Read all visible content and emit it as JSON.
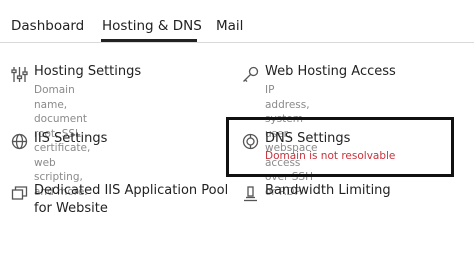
{
  "tabs": [
    {
      "label": "Dashboard"
    },
    {
      "label": "Hosting & DNS"
    },
    {
      "label": "Mail"
    }
  ],
  "items": {
    "hosting_settings": {
      "icon": "sliders-icon",
      "title": "Hosting Settings",
      "desc1": "Domain name, document root, SSL",
      "desc2": "certificate, web scripting, and more."
    },
    "web_hosting_access": {
      "icon": "key-icon",
      "title": "Web Hosting Access",
      "desc1": "IP address, system user, webspace",
      "desc2": "access over SSH or RDP."
    },
    "iis_settings": {
      "icon": "globe-gear-icon",
      "title": "IIS Settings"
    },
    "dns_settings": {
      "icon": "globe-icon",
      "title": "DNS Settings",
      "error": "Domain is not resolvable"
    },
    "dedicated_pool": {
      "icon": "windows-icon",
      "title1": "Dedicated IIS Application Pool",
      "title2": "for Website"
    },
    "bandwidth_limiting": {
      "icon": "bandwidth-icon",
      "title": "Bandwidth Limiting"
    }
  },
  "colors": {
    "error": "#c8323c",
    "highlight_border": "#111111",
    "muted_text": "#8a8a8a"
  }
}
